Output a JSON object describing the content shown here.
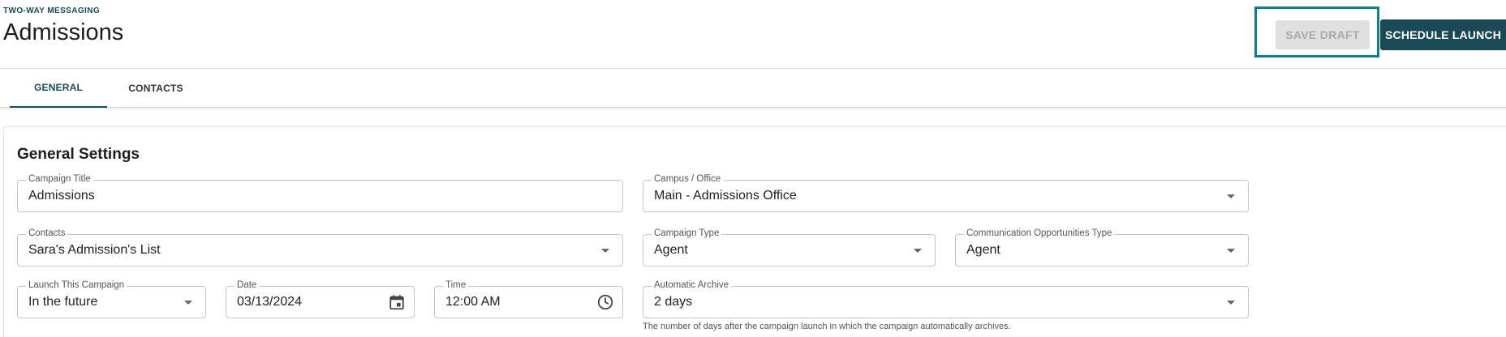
{
  "header": {
    "eyebrow": "TWO-WAY MESSAGING",
    "title": "Admissions",
    "save_draft_label": "SAVE DRAFT",
    "schedule_launch_label": "SCHEDULE LAUNCH"
  },
  "tabs": [
    {
      "label": "GENERAL",
      "active": true
    },
    {
      "label": "CONTACTS",
      "active": false
    }
  ],
  "section": {
    "title": "General Settings"
  },
  "fields": {
    "campaign_title": {
      "label": "Campaign Title",
      "value": "Admissions"
    },
    "campus_office": {
      "label": "Campus / Office",
      "value": "Main - Admissions Office"
    },
    "contacts": {
      "label": "Contacts",
      "value": "Sara's Admission's List"
    },
    "campaign_type": {
      "label": "Campaign Type",
      "value": "Agent"
    },
    "comm_opportunities_type": {
      "label": "Communication Opportunities Type",
      "value": "Agent"
    },
    "launch_campaign": {
      "label": "Launch This Campaign",
      "value": "In the future"
    },
    "date": {
      "label": "Date",
      "value": "03/13/2024"
    },
    "time": {
      "label": "Time",
      "value": "12:00 AM"
    },
    "automatic_archive": {
      "label": "Automatic Archive",
      "value": "2 days",
      "helper": "The number of days after the campaign launch in which the campaign automatically archives."
    }
  },
  "icons": {
    "dropdown": "chevron-down-icon",
    "date": "calendar-icon",
    "time": "clock-icon"
  },
  "colors": {
    "primary": "#1b4a57",
    "highlight": "#0e7f86",
    "disabled_bg": "#e0e0e0",
    "disabled_text": "#a9a9a9"
  }
}
